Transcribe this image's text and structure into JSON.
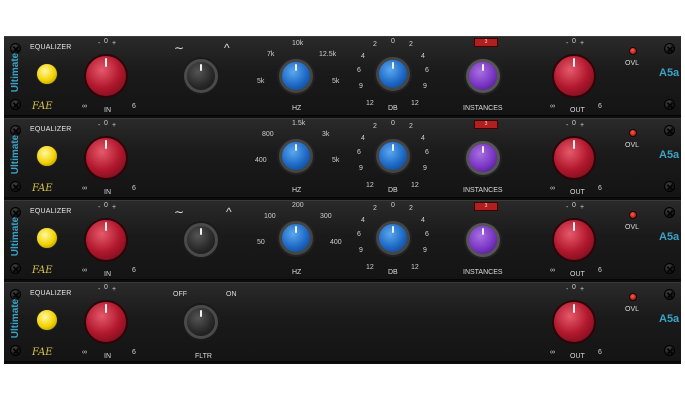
{
  "plugin": {
    "vertical_label": "Ultimate",
    "model_label": "A5a",
    "eq_label": "EQUALIZER",
    "logo_text": "FAE"
  },
  "colors": {
    "panel": "#1e1e1e",
    "in_out_knob": "#b2182e",
    "freq_gain_knob": "#1d68c4",
    "instances_knob": "#7a35c4",
    "power_led": "#f2d200",
    "ovl_led": "#c01010",
    "accent_text": "#3aa3c8"
  },
  "common": {
    "in_label": "IN",
    "out_label": "OUT",
    "ovl_label": "OVL",
    "scale_minus": "-",
    "scale_zero": "0",
    "scale_plus": "+",
    "scale_inf": "∞",
    "scale_six": "6"
  },
  "units": [
    {
      "id": "band-1",
      "shape_icons": [
        "low-shelf-icon",
        "peak-icon"
      ],
      "freq": {
        "label": "HZ",
        "ticks": [
          "10k",
          "7k",
          "12.5k",
          "5k",
          "5k"
        ]
      },
      "gain": {
        "label": "DB",
        "ticks": [
          "2",
          "0",
          "2",
          "4",
          "4",
          "6",
          "6",
          "9",
          "9",
          "12",
          "12"
        ]
      },
      "instances": {
        "label": "INSTANCES",
        "button": "3"
      }
    },
    {
      "id": "band-2",
      "freq": {
        "label": "HZ",
        "ticks": [
          "1.5k",
          "800",
          "3k",
          "400",
          "5k"
        ]
      },
      "gain": {
        "label": "DB",
        "ticks": [
          "2",
          "0",
          "2",
          "4",
          "4",
          "6",
          "6",
          "9",
          "9",
          "12",
          "12"
        ]
      },
      "instances": {
        "label": "INSTANCES",
        "button": "3"
      }
    },
    {
      "id": "band-3",
      "shape_icons": [
        "low-shelf-icon",
        "peak-icon"
      ],
      "freq": {
        "label": "HZ",
        "ticks": [
          "200",
          "100",
          "300",
          "50",
          "400"
        ]
      },
      "gain": {
        "label": "DB",
        "ticks": [
          "2",
          "0",
          "2",
          "4",
          "4",
          "6",
          "6",
          "9",
          "9",
          "12",
          "12"
        ]
      },
      "instances": {
        "label": "INSTANCES",
        "button": "3"
      }
    },
    {
      "id": "filter",
      "filter": {
        "label": "FLTR",
        "off": "OFF",
        "on": "ON"
      }
    }
  ]
}
